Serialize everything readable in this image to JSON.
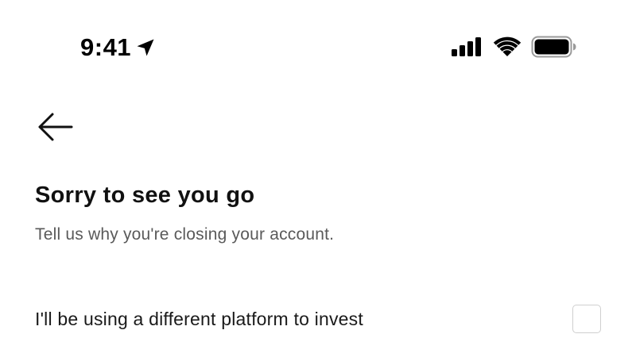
{
  "status_bar": {
    "time": "9:41",
    "icons": [
      "location-arrow-icon",
      "cellular-signal-icon",
      "wifi-icon",
      "battery-icon"
    ]
  },
  "nav": {
    "back_icon": "back-arrow-icon"
  },
  "content": {
    "title": "Sorry to see you go",
    "subtitle": "Tell us why you're closing your account.",
    "options": [
      {
        "label": "I'll be using a different platform to invest",
        "checked": false
      }
    ]
  },
  "colors": {
    "background": "#ffffff",
    "text_primary": "#111111",
    "text_secondary": "#5a5a5a",
    "checkbox_border": "#cfcfcf"
  }
}
